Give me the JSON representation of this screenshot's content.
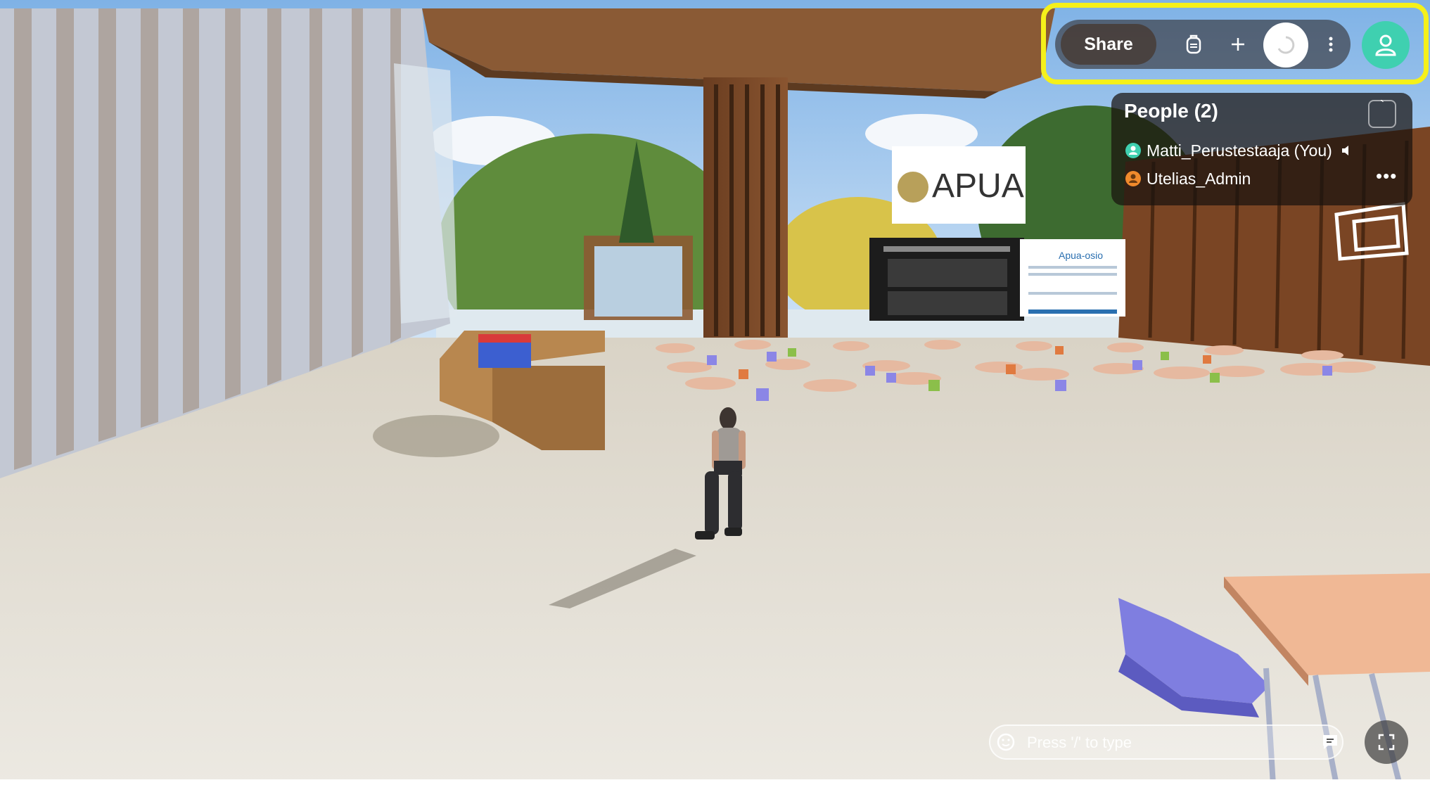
{
  "toolbar": {
    "share_label": "Share",
    "icons": [
      "backpack-icon",
      "plus-icon",
      "loading-spinner-icon",
      "more-vertical-icon",
      "profile-icon"
    ],
    "highlight_color": "#f5f01a",
    "profile_color": "#3fd0b0"
  },
  "scene": {
    "sign_text": "APUA",
    "screen_right_title": "Apua-osio"
  },
  "people": {
    "title": "People (2)",
    "members": [
      {
        "name": "Matti_Perustestaaja (You)",
        "avatar_color": "#3fd0b0",
        "icon": "speaker-icon"
      },
      {
        "name": "Utelias_Admin",
        "avatar_color": "#f08a2c",
        "icon": "more-horizontal-icon"
      }
    ],
    "more_label": "•••"
  },
  "chat": {
    "placeholder": "Press '/' to type"
  }
}
